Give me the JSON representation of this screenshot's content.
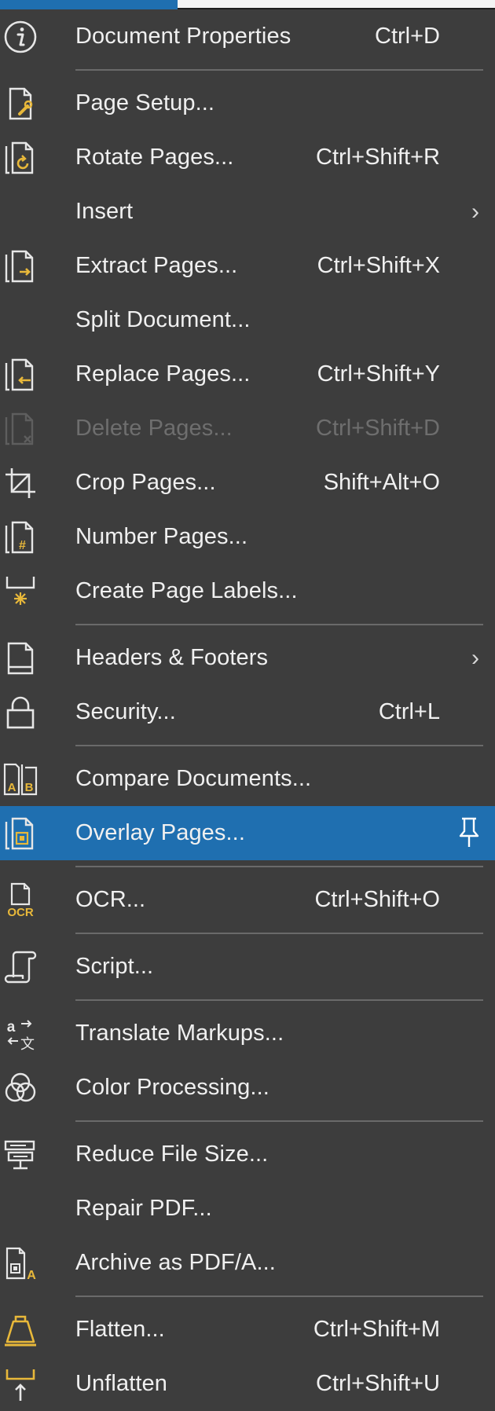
{
  "menu": {
    "items": [
      {
        "label": "Document Properties",
        "shortcut": "Ctrl+D",
        "icon": "info-icon"
      },
      {
        "label": "Page Setup...",
        "shortcut": "",
        "icon": "page-setup-icon"
      },
      {
        "label": "Rotate Pages...",
        "shortcut": "Ctrl+Shift+R",
        "icon": "rotate-pages-icon"
      },
      {
        "label": "Insert",
        "shortcut": "",
        "icon": "",
        "submenu": true
      },
      {
        "label": "Extract Pages...",
        "shortcut": "Ctrl+Shift+X",
        "icon": "extract-pages-icon"
      },
      {
        "label": "Split Document...",
        "shortcut": "",
        "icon": ""
      },
      {
        "label": "Replace Pages...",
        "shortcut": "Ctrl+Shift+Y",
        "icon": "replace-pages-icon"
      },
      {
        "label": "Delete Pages...",
        "shortcut": "Ctrl+Shift+D",
        "icon": "delete-pages-icon",
        "disabled": true
      },
      {
        "label": "Crop Pages...",
        "shortcut": "Shift+Alt+O",
        "icon": "crop-icon"
      },
      {
        "label": "Number Pages...",
        "shortcut": "",
        "icon": "number-pages-icon"
      },
      {
        "label": "Create Page Labels...",
        "shortcut": "",
        "icon": "page-labels-icon"
      },
      {
        "label": "Headers & Footers",
        "shortcut": "",
        "icon": "headers-footers-icon",
        "submenu": true
      },
      {
        "label": "Security...",
        "shortcut": "Ctrl+L",
        "icon": "lock-icon"
      },
      {
        "label": "Compare Documents...",
        "shortcut": "",
        "icon": "compare-icon"
      },
      {
        "label": "Overlay Pages...",
        "shortcut": "",
        "icon": "overlay-pages-icon",
        "highlighted": true
      },
      {
        "label": "OCR...",
        "shortcut": "Ctrl+Shift+O",
        "icon": "ocr-icon"
      },
      {
        "label": "Script...",
        "shortcut": "",
        "icon": "script-icon"
      },
      {
        "label": "Translate Markups...",
        "shortcut": "",
        "icon": "translate-icon"
      },
      {
        "label": "Color Processing...",
        "shortcut": "",
        "icon": "color-processing-icon"
      },
      {
        "label": "Reduce File Size...",
        "shortcut": "",
        "icon": "reduce-file-size-icon"
      },
      {
        "label": "Repair PDF...",
        "shortcut": "",
        "icon": ""
      },
      {
        "label": "Archive as PDF/A...",
        "shortcut": "",
        "icon": "archive-pdfa-icon"
      },
      {
        "label": "Flatten...",
        "shortcut": "Ctrl+Shift+M",
        "icon": "flatten-icon"
      },
      {
        "label": "Unflatten",
        "shortcut": "Ctrl+Shift+U",
        "icon": "unflatten-icon"
      }
    ],
    "ocr_icon_text": "OCR",
    "compare_icon_a": "A",
    "compare_icon_b": "B",
    "archive_icon_a": "A",
    "number_icon_hash": "#",
    "translate_icon_a": "a",
    "translate_icon_char": "文",
    "colors": {
      "background": "#3d3d3d",
      "highlight": "#1f6fb0",
      "separator": "#6a6a6a",
      "accent_icon": "#e8b83a"
    }
  }
}
